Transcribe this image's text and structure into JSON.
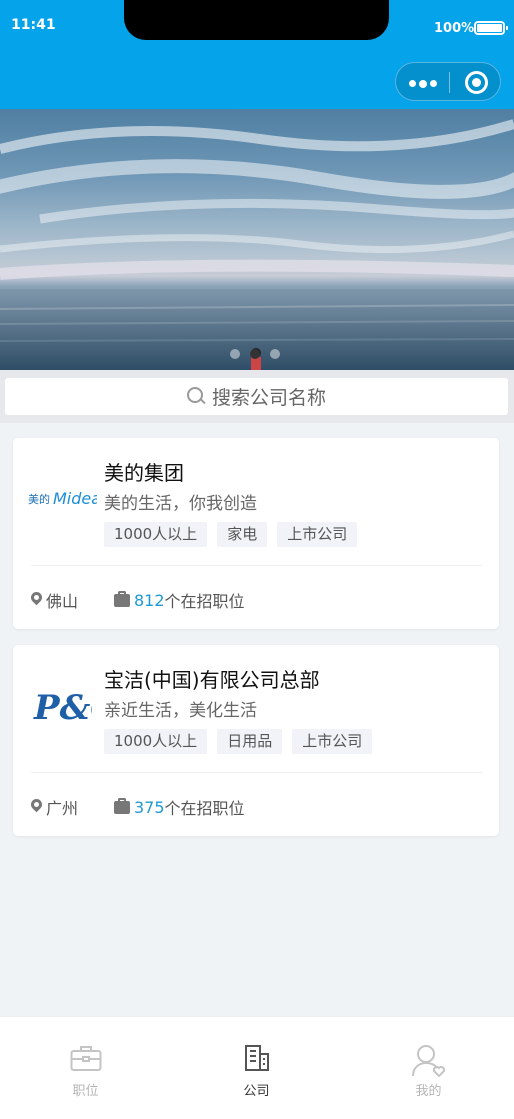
{
  "status_bar": {
    "time": "11:41",
    "battery": "100%"
  },
  "banner": {
    "dots": 3,
    "active_index": 1
  },
  "search": {
    "placeholder": "搜索公司名称"
  },
  "companies": [
    {
      "name": "美的集团",
      "slogan": "美的生活，你我创造",
      "logo_text": "美的 Midea",
      "tags": [
        "1000人以上",
        "家电",
        "上市公司"
      ],
      "city": "佛山",
      "job_count": "812",
      "job_suffix": "个在招职位"
    },
    {
      "name": "宝洁(中国)有限公司总部",
      "slogan": "亲近生活，美化生活",
      "logo_text": "P&G",
      "tags": [
        "1000人以上",
        "日用品",
        "上市公司"
      ],
      "city": "广州",
      "job_count": "375",
      "job_suffix": "个在招职位"
    }
  ],
  "tabbar": {
    "items": [
      {
        "label": "职位",
        "icon": "briefcase-icon",
        "active": false
      },
      {
        "label": "公司",
        "icon": "building-icon",
        "active": true
      },
      {
        "label": "我的",
        "icon": "user-icon",
        "active": false
      }
    ]
  },
  "colors": {
    "primary": "#05a3ea",
    "link": "#1d9ad6"
  }
}
